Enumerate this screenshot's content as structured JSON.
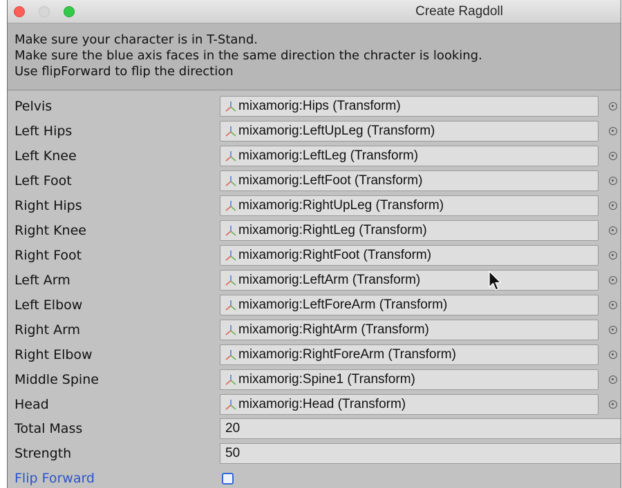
{
  "window": {
    "title": "Create Ragdoll"
  },
  "help": {
    "lines": [
      "Make sure your character is in T-Stand.",
      "Make sure the blue axis faces in the same direction the chracter is looking.",
      "Use flipForward to flip the direction"
    ]
  },
  "bones": [
    {
      "label": "Pelvis",
      "value": "mixamorig:Hips (Transform)"
    },
    {
      "label": "Left Hips",
      "value": "mixamorig:LeftUpLeg (Transform)"
    },
    {
      "label": "Left Knee",
      "value": "mixamorig:LeftLeg (Transform)"
    },
    {
      "label": "Left Foot",
      "value": "mixamorig:LeftFoot (Transform)"
    },
    {
      "label": "Right Hips",
      "value": "mixamorig:RightUpLeg (Transform)"
    },
    {
      "label": "Right Knee",
      "value": "mixamorig:RightLeg (Transform)"
    },
    {
      "label": "Right Foot",
      "value": "mixamorig:RightFoot (Transform)"
    },
    {
      "label": "Left Arm",
      "value": "mixamorig:LeftArm (Transform)"
    },
    {
      "label": "Left Elbow",
      "value": "mixamorig:LeftForeArm (Transform)"
    },
    {
      "label": "Right Arm",
      "value": "mixamorig:RightArm (Transform)"
    },
    {
      "label": "Right Elbow",
      "value": "mixamorig:RightForeArm (Transform)"
    },
    {
      "label": "Middle Spine",
      "value": "mixamorig:Spine1 (Transform)"
    },
    {
      "label": "Head",
      "value": "mixamorig:Head (Transform)"
    }
  ],
  "total_mass": {
    "label": "Total Mass",
    "value": "20"
  },
  "strength": {
    "label": "Strength",
    "value": "50"
  },
  "flip_forward": {
    "label": "Flip Forward",
    "checked": false
  },
  "icons": {
    "field_icon": "transform-icon",
    "picker_icon": "object-picker-icon"
  },
  "colors": {
    "flip_forward_label": "#2b55c9",
    "close": "#fc5e58",
    "maximize": "#35c94a"
  }
}
